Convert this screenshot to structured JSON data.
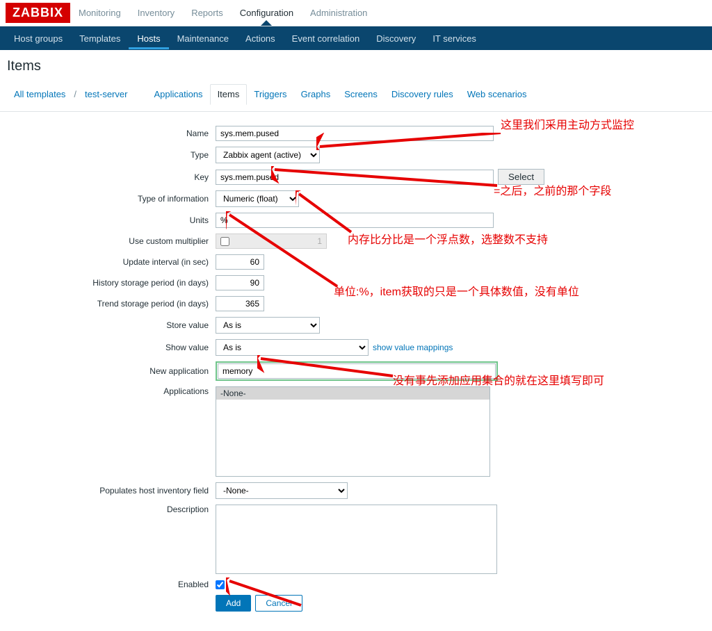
{
  "logo": "ZABBIX",
  "topMenu": {
    "monitoring": "Monitoring",
    "inventory": "Inventory",
    "reports": "Reports",
    "configuration": "Configuration",
    "administration": "Administration"
  },
  "subMenu": {
    "hostGroups": "Host groups",
    "templates": "Templates",
    "hosts": "Hosts",
    "maintenance": "Maintenance",
    "actions": "Actions",
    "eventCorrelation": "Event correlation",
    "discovery": "Discovery",
    "itServices": "IT services"
  },
  "pageTitle": "Items",
  "breadcrumb": {
    "allTemplates": "All templates",
    "host": "test-server",
    "applications": "Applications",
    "items": "Items",
    "triggers": "Triggers",
    "graphs": "Graphs",
    "screens": "Screens",
    "discoveryRules": "Discovery rules",
    "webScenarios": "Web scenarios"
  },
  "labels": {
    "name": "Name",
    "type": "Type",
    "key": "Key",
    "typeOfInformation": "Type of information",
    "units": "Units",
    "useCustomMultiplier": "Use custom multiplier",
    "updateInterval": "Update interval (in sec)",
    "historyStorage": "History storage period (in days)",
    "trendStorage": "Trend storage period (in days)",
    "storeValue": "Store value",
    "showValue": "Show value",
    "newApplication": "New application",
    "applications": "Applications",
    "populatesHostInventory": "Populates host inventory field",
    "description": "Description",
    "enabled": "Enabled"
  },
  "values": {
    "name": "sys.mem.pused",
    "type": "Zabbix agent (active)",
    "key": "sys.mem.pused",
    "typeOfInformation": "Numeric (float)",
    "units": "%",
    "customMultiplier": "1",
    "updateInterval": "60",
    "historyStorage": "90",
    "trendStorage": "365",
    "storeValue": "As is",
    "showValue": "As is",
    "newApplication": "memory",
    "applicationsOption": "-None-",
    "populatesHostInventory": "-None-",
    "description": ""
  },
  "buttons": {
    "select": "Select",
    "add": "Add",
    "cancel": "Cancel"
  },
  "links": {
    "showValueMappings": "show value mappings"
  },
  "annotations": {
    "a1": "这里我们采用主动方式监控",
    "a2": "=之后，之前的那个字段",
    "a3": "内存比分比是一个浮点数，选整数不支持",
    "a4": "单位:%，item获取的只是一个具体数值，没有单位",
    "a5": "没有事先添加应用集合的就在这里填写即可"
  }
}
